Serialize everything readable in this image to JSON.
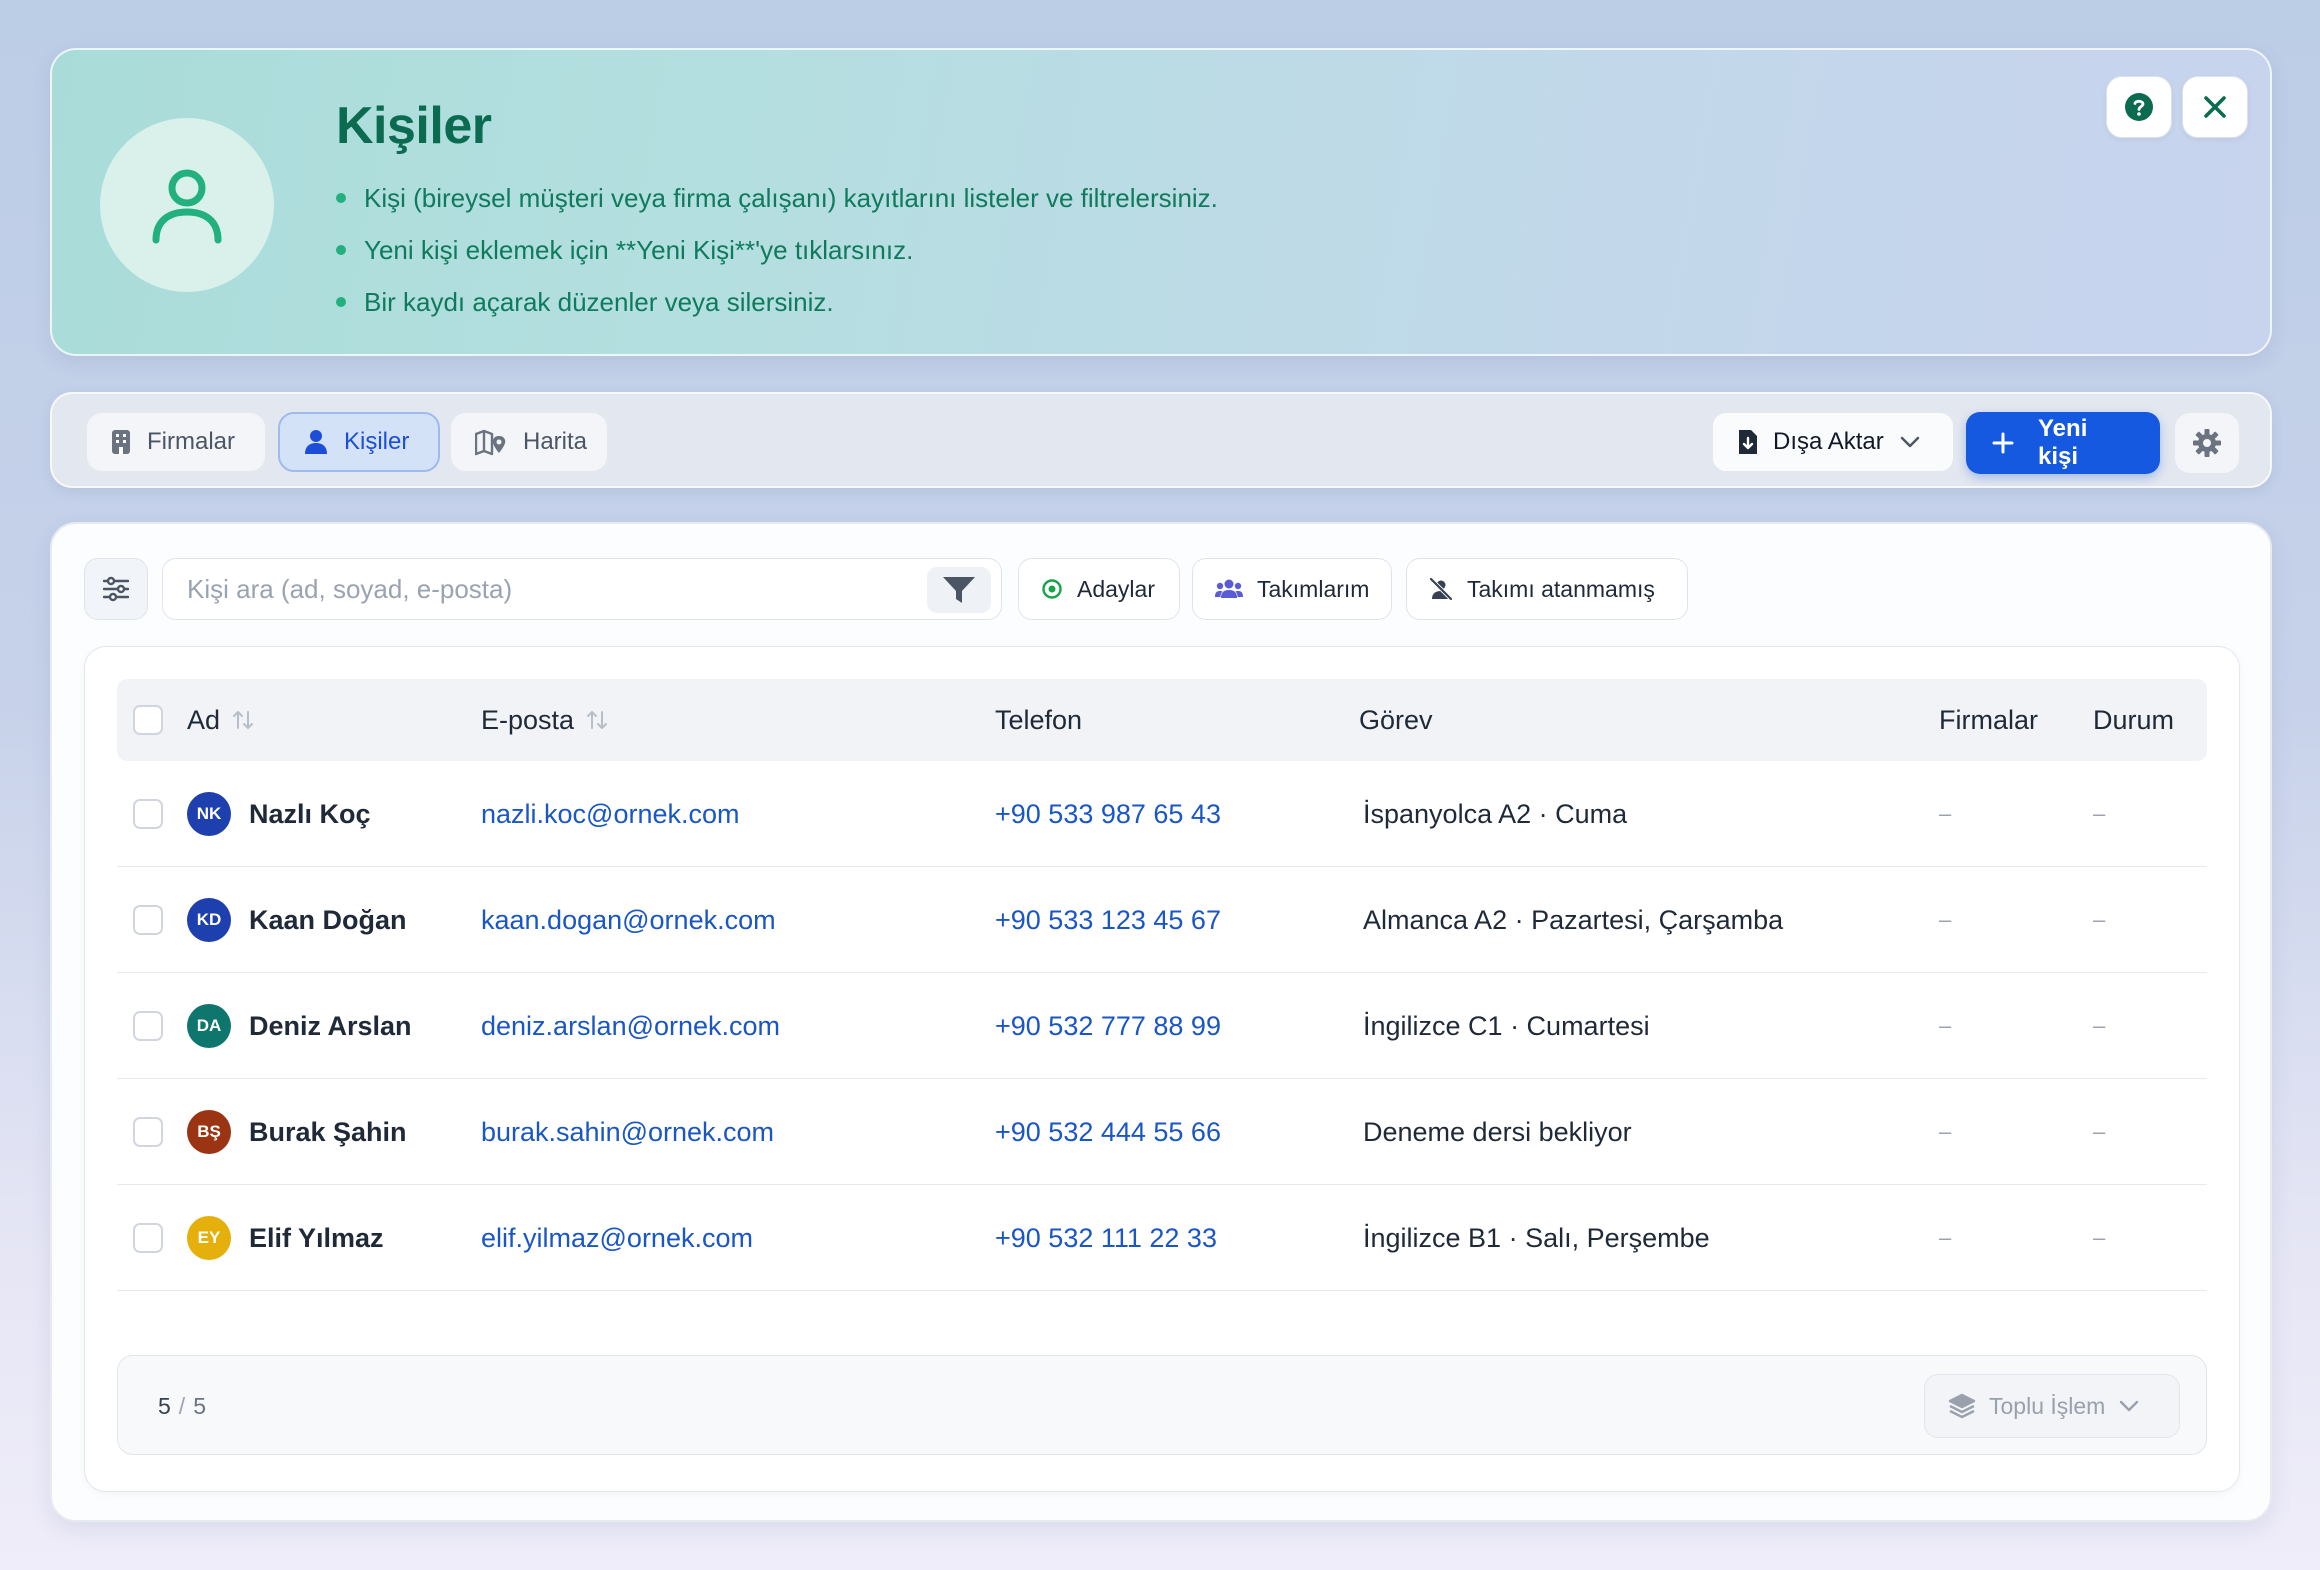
{
  "hero": {
    "title": "Kişiler",
    "bullets": [
      "Kişi (bireysel müşteri veya firma çalışanı) kayıtlarını listeler ve filtrelersiniz.",
      "Yeni kişi eklemek için **Yeni Kişi**'ye tıklarsınız.",
      "Bir kaydı açarak düzenler veya silersiniz."
    ],
    "accent": "#0b6b50"
  },
  "tabs": [
    {
      "label": "Firmalar",
      "icon": "building-icon",
      "active": false
    },
    {
      "label": "Kişiler",
      "icon": "person-icon",
      "active": true
    },
    {
      "label": "Harita",
      "icon": "map-pin-icon",
      "active": false
    }
  ],
  "toolbar": {
    "export_label": "Dışa Aktar",
    "new_label": "Yeni kişi",
    "primary_color": "#1559e0"
  },
  "search": {
    "placeholder": "Kişi ara (ad, soyad, e-posta)",
    "value": ""
  },
  "chips": [
    {
      "label": "Adaylar",
      "icon": "target-icon"
    },
    {
      "label": "Takımlarım",
      "icon": "team-icon"
    },
    {
      "label": "Takımı atanmamış",
      "icon": "user-off-icon"
    }
  ],
  "table": {
    "columns": [
      "Ad",
      "E-posta",
      "Telefon",
      "Görev",
      "Firmalar",
      "Durum"
    ],
    "rows": [
      {
        "initials": "NK",
        "avatar_color": "#1e3fae",
        "name": "Nazlı Koç",
        "email": "nazli.koc@ornek.com",
        "phone": "+90 533 987 65 43",
        "role": "İspanyolca A2 · Cuma",
        "firms": "–",
        "status": "–"
      },
      {
        "initials": "KD",
        "avatar_color": "#1e3fae",
        "name": "Kaan Doğan",
        "email": "kaan.dogan@ornek.com",
        "phone": "+90 533 123 45 67",
        "role": "Almanca A2 · Pazartesi, Çarşamba",
        "firms": "–",
        "status": "–"
      },
      {
        "initials": "DA",
        "avatar_color": "#0f766e",
        "name": "Deniz Arslan",
        "email": "deniz.arslan@ornek.com",
        "phone": "+90 532 777 88 99",
        "role": "İngilizce C1 · Cumartesi",
        "firms": "–",
        "status": "–"
      },
      {
        "initials": "BŞ",
        "avatar_color": "#9a3412",
        "name": "Burak Şahin",
        "email": "burak.sahin@ornek.com",
        "phone": "+90 532 444 55 66",
        "role": "Deneme dersi bekliyor",
        "firms": "–",
        "status": "–"
      },
      {
        "initials": "EY",
        "avatar_color": "#e6b00c",
        "name": "Elif Yılmaz",
        "email": "elif.yilmaz@ornek.com",
        "phone": "+90 532 111 22 33",
        "role": "İngilizce B1 · Salı, Perşembe",
        "firms": "–",
        "status": "–"
      }
    ]
  },
  "footer": {
    "shown": "5",
    "separator": "/",
    "total": "5",
    "bulk_label": "Toplu İşlem"
  }
}
